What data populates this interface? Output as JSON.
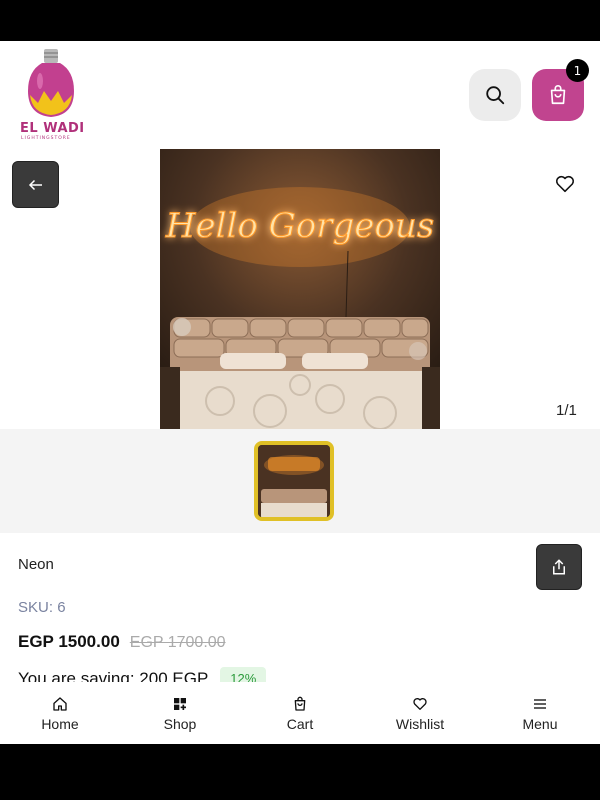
{
  "header": {
    "logo_text": "EL WADI",
    "logo_subtext": "LIGHTINGSTORE",
    "search_icon": "search-icon",
    "cart_icon": "shopping-bag-icon",
    "cart_count": "1"
  },
  "gallery": {
    "back_icon": "arrow-left-icon",
    "wishlist_icon": "heart-icon",
    "image_counter": "1/1",
    "neon_text": "Hello Gorgeous"
  },
  "product": {
    "name": "Neon",
    "sku_label": "SKU:",
    "sku_value": "6",
    "price": "EGP 1500.00",
    "old_price": "EGP 1700.00",
    "saving_text": "You are saving: 200 EGP",
    "discount": "12%",
    "share_icon": "share-icon"
  },
  "bottom_nav": {
    "items": [
      {
        "label": "Home",
        "icon": "home-icon"
      },
      {
        "label": "Shop",
        "icon": "grid-add-icon"
      },
      {
        "label": "Cart",
        "icon": "shopping-bag-icon"
      },
      {
        "label": "Wishlist",
        "icon": "heart-icon"
      },
      {
        "label": "Menu",
        "icon": "menu-icon"
      }
    ]
  },
  "colors": {
    "brand": "#c1448f",
    "accent_border": "#e0c026",
    "discount_green": "#2a9a3a"
  }
}
